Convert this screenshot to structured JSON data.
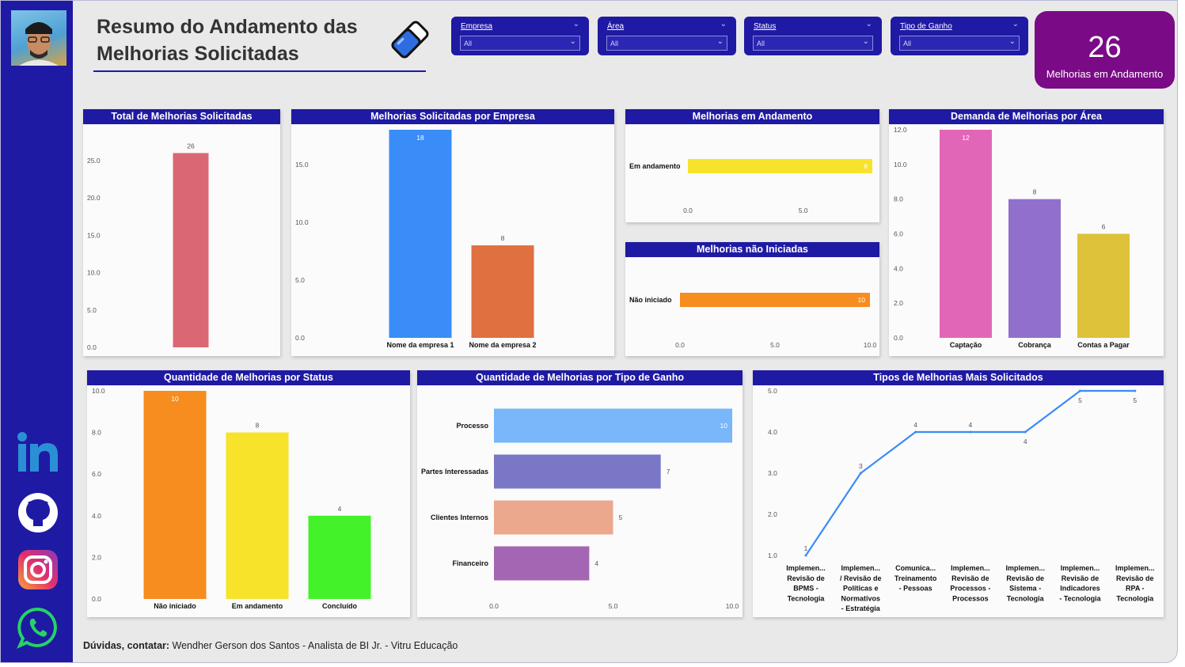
{
  "header": {
    "title_line1": "Resumo do Andamento das",
    "title_line2": "Melhorias Solicitadas"
  },
  "filters": [
    {
      "label": "Empresa",
      "value": "All"
    },
    {
      "label": "Área",
      "value": "All"
    },
    {
      "label": "Status",
      "value": "All"
    },
    {
      "label": "Tipo de Ganho",
      "value": "All"
    }
  ],
  "kpi": {
    "value": "26",
    "label": "Melhorias em Andamento"
  },
  "social": [
    "linkedin-icon",
    "github-icon",
    "instagram-icon",
    "whatsapp-icon"
  ],
  "colors": {
    "brand": "#1f1aa3",
    "kpi": "#7a0a86",
    "background": "#e9e9e9"
  },
  "footer": {
    "prefix": "Dúvidas, contatar:",
    "text": " Wendher Gerson dos Santos - Analista de BI Jr. - Vitru Educação"
  },
  "chart_data": [
    {
      "id": "total",
      "type": "bar",
      "title": "Total de Melhorias Solicitadas",
      "categories": [
        ""
      ],
      "values": [
        26
      ],
      "ylim": [
        0,
        27
      ],
      "yticks": [
        "0.0",
        "5.0",
        "10.0",
        "15.0",
        "20.0",
        "25.0"
      ],
      "colors": [
        "#d96873"
      ]
    },
    {
      "id": "empresa",
      "type": "bar",
      "title": "Melhorias Solicitadas por Empresa",
      "categories": [
        "Nome da empresa 1",
        "Nome da empresa 2"
      ],
      "values": [
        18,
        8
      ],
      "ylim": [
        0,
        18
      ],
      "yticks": [
        "0.0",
        "5.0",
        "10.0",
        "15.0"
      ],
      "colors": [
        "#3a8cf8",
        "#e07040"
      ]
    },
    {
      "id": "andamento",
      "type": "bar",
      "orientation": "horizontal",
      "title": "Melhorias em Andamento",
      "categories": [
        "Em andamento"
      ],
      "values": [
        8
      ],
      "xlim": [
        0,
        8
      ],
      "xticks": [
        "0.0",
        "5.0"
      ],
      "colors": [
        "#f7e32a"
      ]
    },
    {
      "id": "nao_iniciadas",
      "type": "bar",
      "orientation": "horizontal",
      "title": "Melhorias não Iniciadas",
      "categories": [
        "Não iniciado"
      ],
      "values": [
        10
      ],
      "xlim": [
        0,
        10
      ],
      "xticks": [
        "0.0",
        "5.0",
        "10.0"
      ],
      "colors": [
        "#f78c1f"
      ]
    },
    {
      "id": "area",
      "type": "bar",
      "title": "Demanda de Melhorias por Área",
      "categories": [
        "Captação",
        "Cobrança",
        "Contas a Pagar"
      ],
      "values": [
        12,
        8,
        6
      ],
      "ylim": [
        0,
        12
      ],
      "yticks": [
        "0.0",
        "2.0",
        "4.0",
        "6.0",
        "8.0",
        "10.0",
        "12.0"
      ],
      "colors": [
        "#e266b8",
        "#9070cc",
        "#ddc23a"
      ]
    },
    {
      "id": "status",
      "type": "bar",
      "title": "Quantidade de Melhorias por Status",
      "categories": [
        "Não iniciado",
        "Em andamento",
        "Concluído"
      ],
      "values": [
        10,
        8,
        4
      ],
      "ylim": [
        0,
        10
      ],
      "yticks": [
        "0.0",
        "2.0",
        "4.0",
        "6.0",
        "8.0",
        "10.0"
      ],
      "colors": [
        "#f78c1f",
        "#f7e32a",
        "#44f22a"
      ]
    },
    {
      "id": "ganho",
      "type": "bar",
      "orientation": "horizontal",
      "title": "Quantidade de Melhorias por Tipo de Ganho",
      "categories": [
        "Processo",
        "Partes Interessadas",
        "Clientes Internos",
        "Financeiro"
      ],
      "values": [
        10,
        7,
        5,
        4
      ],
      "xlim": [
        0,
        10
      ],
      "xticks": [
        "0.0",
        "5.0",
        "10.0"
      ],
      "colors": [
        "#79b6fa",
        "#7a78c6",
        "#eba88c",
        "#a466b2"
      ]
    },
    {
      "id": "tipos",
      "type": "line",
      "title": "Tipos de Melhorias Mais Solicitados",
      "categories": [
        [
          "Implemen...",
          "Revisão de",
          "BPMS -",
          "Tecnologia"
        ],
        [
          "Implemen...",
          "/ Revisão de",
          "Políticas e",
          "Normativos",
          "- Estratégia"
        ],
        [
          "Comunica...",
          "Treinamento",
          "- Pessoas"
        ],
        [
          "Implemen...",
          "Revisão de",
          "Processos -",
          "Processos"
        ],
        [
          "Implemen...",
          "Revisão de",
          "Sistema -",
          "Tecnologia"
        ],
        [
          "Implemen...",
          "Revisão de",
          "Indicadores",
          "- Tecnologia"
        ],
        [
          "Implemen...",
          "Revisão de",
          "RPA -",
          "Tecnologia"
        ]
      ],
      "values": [
        1,
        3,
        4,
        4,
        4,
        5,
        5
      ],
      "ylim": [
        1,
        5
      ],
      "yticks": [
        "1.0",
        "2.0",
        "3.0",
        "4.0",
        "5.0"
      ],
      "colors": [
        "#3a8cf8"
      ]
    }
  ]
}
